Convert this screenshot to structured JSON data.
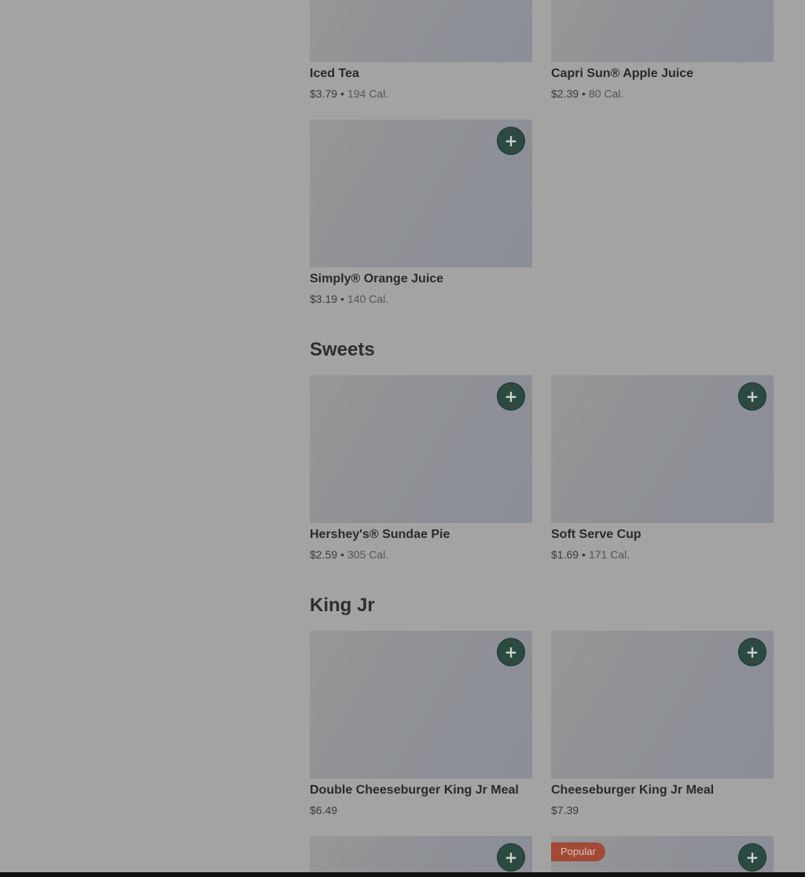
{
  "colors": {
    "overlay_background": "#a3a3a3",
    "add_button": "#2d4a42",
    "popular_badge": "#a24a36"
  },
  "sections": {
    "beverages_top": {
      "items": [
        {
          "name": "Iced Tea",
          "price": "$3.79",
          "calories": "194 Cal."
        },
        {
          "name": "Capri Sun® Apple Juice",
          "price": "$2.39",
          "calories": "80 Cal."
        },
        {
          "name": "Simply® Orange Juice",
          "price": "$3.19",
          "calories": "140 Cal."
        }
      ]
    },
    "sweets": {
      "title": "Sweets",
      "items": [
        {
          "name": "Hershey's® Sundae Pie",
          "price": "$2.59",
          "calories": "305 Cal."
        },
        {
          "name": "Soft Serve Cup",
          "price": "$1.69",
          "calories": "171 Cal."
        }
      ]
    },
    "king_jr": {
      "title": "King Jr",
      "items": [
        {
          "name": "Double Cheeseburger King Jr Meal",
          "price": "$6.49"
        },
        {
          "name": "Cheeseburger King Jr Meal",
          "price": "$7.39"
        }
      ],
      "popular_label": "Popular"
    }
  },
  "icons": {
    "add": "plus-icon",
    "separator": "•",
    "plus_glyph": "+"
  }
}
